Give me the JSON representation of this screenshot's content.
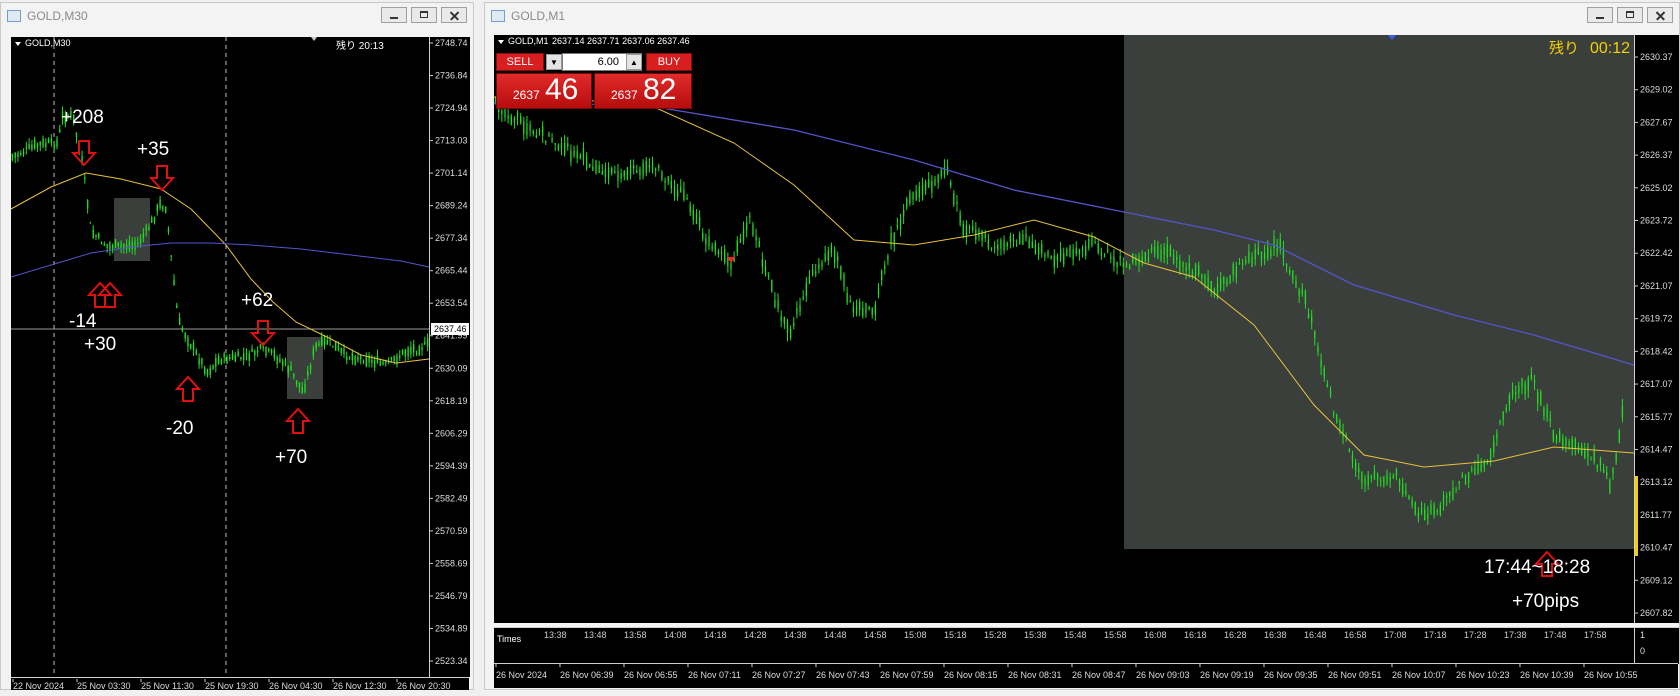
{
  "left_window": {
    "title": "GOLD,M30",
    "chart_label": "GOLD,M30",
    "remaining": "残り 20:13",
    "current_price": "2637.46",
    "price_ticks": [
      "2748.74",
      "2736.84",
      "2724.94",
      "2713.03",
      "2701.14",
      "2689.24",
      "2677.34",
      "2665.44",
      "2653.54",
      "2641.99",
      "2630.09",
      "2618.19",
      "2606.29",
      "2594.39",
      "2582.49",
      "2570.59",
      "2558.69",
      "2546.79",
      "2534.89",
      "2523.34"
    ],
    "time_ticks": [
      "22 Nov 2024",
      "25 Nov 03:30",
      "25 Nov 11:30",
      "25 Nov 19:30",
      "26 Nov 04:30",
      "26 Nov 12:30",
      "26 Nov 20:30"
    ],
    "annotations": [
      "+208",
      "+35",
      "-14",
      "+30",
      "+62",
      "-20",
      "+70"
    ]
  },
  "right_window": {
    "title": "GOLD,M1",
    "chart_label": "GOLD,M1",
    "ohlc": "2637.14 2637.71 2637.06 2637.46",
    "remaining_label": "残り",
    "remaining_time": "00:12",
    "sell_label": "SELL",
    "buy_label": "BUY",
    "lot": "6.00",
    "sell_price_small": "2637",
    "sell_price_big": "46",
    "buy_price_small": "2637",
    "buy_price_big": "82",
    "price_ticks": [
      "2630.37",
      "2629.02",
      "2627.67",
      "2626.37",
      "2625.02",
      "2623.72",
      "2622.42",
      "2621.07",
      "2619.72",
      "2618.42",
      "2617.07",
      "2615.77",
      "2614.47",
      "2613.12",
      "2611.77",
      "2610.47",
      "2609.12",
      "2607.82"
    ],
    "sub_ticks": [
      "1",
      "0"
    ],
    "sub_label": "Times",
    "sub_times": [
      "13:38",
      "13:48",
      "13:58",
      "14:08",
      "14:18",
      "14:28",
      "14:38",
      "14:48",
      "14:58",
      "15:08",
      "15:18",
      "15:28",
      "15:38",
      "15:48",
      "15:58",
      "16:08",
      "16:18",
      "16:28",
      "16:38",
      "16:48",
      "16:58",
      "17:08",
      "17:18",
      "17:28",
      "17:38",
      "17:48",
      "17:58"
    ],
    "time_ticks": [
      "26 Nov 2024",
      "26 Nov 06:39",
      "26 Nov 06:55",
      "26 Nov 07:11",
      "26 Nov 07:27",
      "26 Nov 07:43",
      "26 Nov 07:59",
      "26 Nov 08:15",
      "26 Nov 08:31",
      "26 Nov 08:47",
      "26 Nov 09:03",
      "26 Nov 09:19",
      "26 Nov 09:35",
      "26 Nov 09:51",
      "26 Nov 10:07",
      "26 Nov 10:23",
      "26 Nov 10:39",
      "26 Nov 10:55"
    ],
    "annotation_time": "17:44~18:28",
    "annotation_pips": "+70pips"
  },
  "colors": {
    "candle": "#22dd22",
    "ma_fast": "#e8c23a",
    "ma_slow": "#5555cc",
    "arrow": "#e01010",
    "shade": "#3a3f3c"
  }
}
